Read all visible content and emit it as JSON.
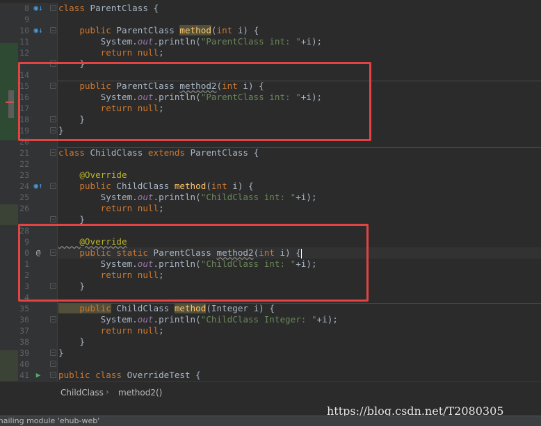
{
  "gutter_icons": {
    "override_up": "override-marker-icon",
    "implemented_up": "overrides-up-icon",
    "run": "run-icon",
    "annotation": "annotation-marker-icon"
  },
  "lines": [
    {
      "n": "8",
      "tokens": [
        [
          "kw",
          "class "
        ],
        [
          "",
          "ParentClass {"
        ]
      ]
    },
    {
      "n": "9",
      "tokens": []
    },
    {
      "n": "10",
      "tokens": [
        [
          "kw",
          "    public "
        ],
        [
          "",
          "ParentClass "
        ],
        [
          "fn hl",
          "method"
        ],
        [
          "",
          "("
        ],
        [
          "kw",
          "int "
        ],
        [
          "",
          "i) {"
        ]
      ]
    },
    {
      "n": "11",
      "tokens": [
        [
          "",
          "        System."
        ],
        [
          "st",
          "out"
        ],
        [
          "",
          ".println("
        ],
        [
          "str",
          "\"ParentClass int: \""
        ],
        [
          "",
          "+i);"
        ]
      ]
    },
    {
      "n": "12",
      "tokens": [
        [
          "kw",
          "        return null"
        ],
        [
          "",
          ";"
        ]
      ]
    },
    {
      "n": "",
      "tokens": [
        [
          "",
          "    }"
        ]
      ]
    },
    {
      "n": "14",
      "tokens": []
    },
    {
      "n": "15",
      "tokens": [
        [
          "kw",
          "    public "
        ],
        [
          "",
          "ParentClass "
        ],
        [
          "sq",
          "method2"
        ],
        [
          "",
          "("
        ],
        [
          "kw",
          "int "
        ],
        [
          "",
          "i) {"
        ]
      ]
    },
    {
      "n": "16",
      "tokens": [
        [
          "",
          "        System."
        ],
        [
          "st",
          "out"
        ],
        [
          "",
          ".println("
        ],
        [
          "str",
          "\"ParentClass int: \""
        ],
        [
          "",
          "+i);"
        ]
      ]
    },
    {
      "n": "17",
      "tokens": [
        [
          "kw",
          "        return null"
        ],
        [
          "",
          ";"
        ]
      ]
    },
    {
      "n": "18",
      "tokens": [
        [
          "",
          "    }"
        ]
      ]
    },
    {
      "n": "19",
      "tokens": [
        [
          "",
          "}"
        ]
      ]
    },
    {
      "n": "20",
      "tokens": []
    },
    {
      "n": "21",
      "tokens": [
        [
          "kw",
          "class "
        ],
        [
          "",
          "ChildClass "
        ],
        [
          "kw",
          "extends "
        ],
        [
          "",
          "ParentClass {"
        ]
      ]
    },
    {
      "n": "22",
      "tokens": []
    },
    {
      "n": "23",
      "tokens": [
        [
          "ann",
          "    @Override"
        ]
      ]
    },
    {
      "n": "24",
      "tokens": [
        [
          "kw",
          "    public "
        ],
        [
          "",
          "ChildClass "
        ],
        [
          "fn",
          "method"
        ],
        [
          "",
          "("
        ],
        [
          "kw",
          "int "
        ],
        [
          "",
          "i) {"
        ]
      ]
    },
    {
      "n": "25",
      "tokens": [
        [
          "",
          "        System."
        ],
        [
          "st",
          "out"
        ],
        [
          "",
          ".println("
        ],
        [
          "str",
          "\"ChildClass int: \""
        ],
        [
          "",
          "+i);"
        ]
      ]
    },
    {
      "n": "26",
      "tokens": [
        [
          "kw",
          "        return null"
        ],
        [
          "",
          ";"
        ]
      ]
    },
    {
      "n": "",
      "tokens": [
        [
          "",
          "    }"
        ]
      ]
    },
    {
      "n": "28",
      "tokens": []
    },
    {
      "n": "9",
      "tokens": [
        [
          "ann sq",
          "    @Override"
        ]
      ]
    },
    {
      "n": "0",
      "tokens": [
        [
          "kw",
          "    public static "
        ],
        [
          "",
          "ParentClass "
        ],
        [
          "sq",
          "method2"
        ],
        [
          "",
          "("
        ],
        [
          "kw",
          "int "
        ],
        [
          "",
          "i) {"
        ]
      ]
    },
    {
      "n": "1",
      "tokens": [
        [
          "",
          "        System."
        ],
        [
          "st",
          "out"
        ],
        [
          "",
          ".println("
        ],
        [
          "str",
          "\"ChildClass int: \""
        ],
        [
          "",
          "+i);"
        ]
      ]
    },
    {
      "n": "2",
      "tokens": [
        [
          "kw",
          "        return null"
        ],
        [
          "",
          ";"
        ]
      ]
    },
    {
      "n": "3",
      "tokens": [
        [
          "",
          "    }"
        ]
      ]
    },
    {
      "n": "4",
      "tokens": []
    },
    {
      "n": "35",
      "tokens": [
        [
          "kw hl",
          "    public"
        ],
        [
          "kw",
          " "
        ],
        [
          "",
          "ChildClass "
        ],
        [
          "fn hl",
          "method"
        ],
        [
          "",
          "(Integer i) {"
        ]
      ]
    },
    {
      "n": "36",
      "tokens": [
        [
          "",
          "        System."
        ],
        [
          "st",
          "out"
        ],
        [
          "",
          ".println("
        ],
        [
          "str",
          "\"ChildClass Integer: \""
        ],
        [
          "",
          "+i);"
        ]
      ]
    },
    {
      "n": "37",
      "tokens": [
        [
          "kw",
          "        return null"
        ],
        [
          "",
          ";"
        ]
      ]
    },
    {
      "n": "38",
      "tokens": [
        [
          "",
          "    }"
        ]
      ]
    },
    {
      "n": "39",
      "tokens": [
        [
          "",
          "}"
        ]
      ]
    },
    {
      "n": "40",
      "tokens": []
    },
    {
      "n": "41",
      "tokens": [
        [
          "kw",
          "public class "
        ],
        [
          "",
          "OverrideTest {"
        ]
      ]
    }
  ],
  "breadcrumb": {
    "class_name": "ChildClass",
    "separator": "›",
    "method_name": "method2()"
  },
  "watermark": "https://blog.csdn.net/T2080305",
  "status_text": "mailing module 'ehub-web'",
  "colors": {
    "highlight_box": "#e24444",
    "background": "#2b2b2b",
    "keyword": "#cc7832",
    "string": "#6a8759"
  }
}
